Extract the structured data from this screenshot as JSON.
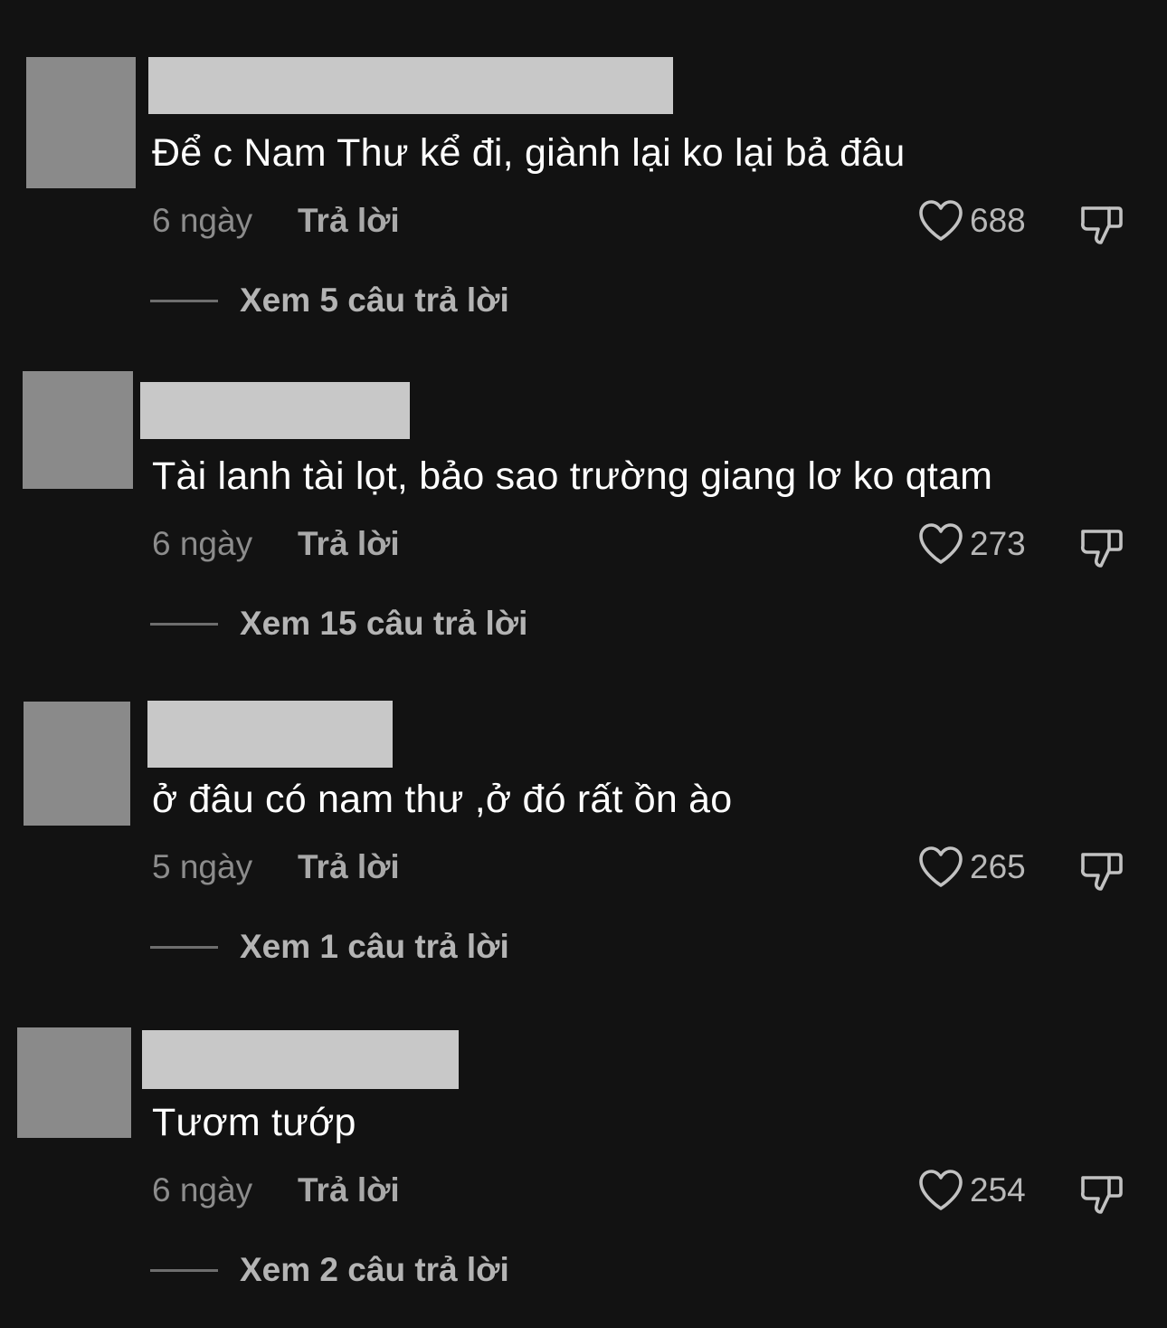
{
  "comments": [
    {
      "text": "Để c Nam Thư kể đi, giành lại ko lại bả đâu",
      "time": "6 ngày",
      "reply_label": "Trả lời",
      "likes": "688",
      "view_replies": "Xem 5 câu trả lời"
    },
    {
      "text": "Tài lanh tài lọt, bảo sao trường giang lơ ko qtam",
      "time": "6 ngày",
      "reply_label": "Trả lời",
      "likes": "273",
      "view_replies": "Xem 15 câu trả lời"
    },
    {
      "text": "ở đâu có nam thư ,ở đó rất ồn ào",
      "time": "5 ngày",
      "reply_label": "Trả lời",
      "likes": "265",
      "view_replies": "Xem 1 câu trả lời"
    },
    {
      "text": "Tươm tướp",
      "time": "6 ngày",
      "reply_label": "Trả lời",
      "likes": "254",
      "view_replies": "Xem 2 câu trả lời"
    }
  ],
  "colors": {
    "background": "#121212",
    "avatar_placeholder": "#8a8a8a",
    "name_placeholder": "#c8c8c8"
  },
  "icons": {
    "like": "heart-outline-icon",
    "dislike": "thumbs-down-outline-icon"
  }
}
